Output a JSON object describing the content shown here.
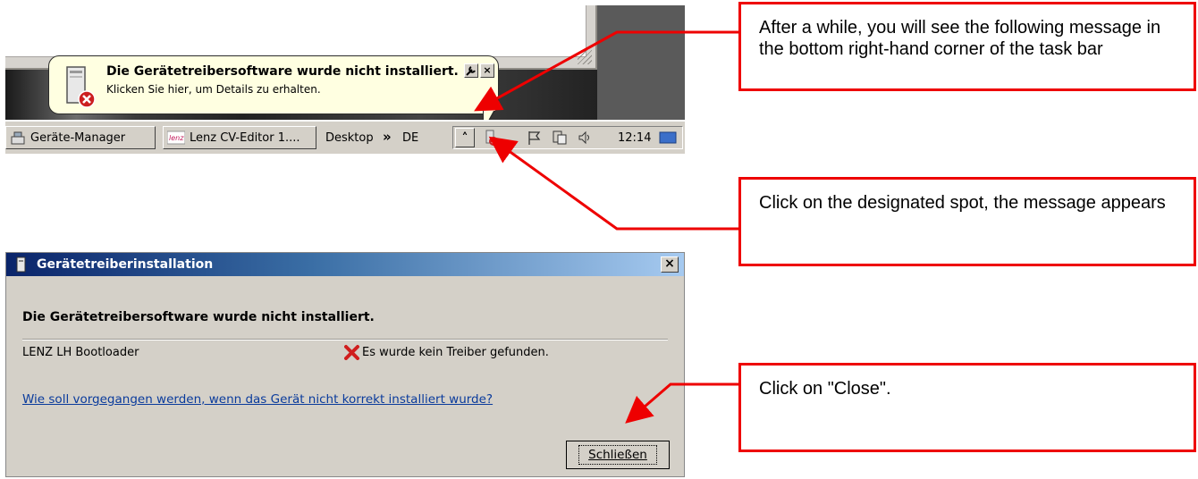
{
  "notification": {
    "title": "Die Gerätetreibersoftware wurde nicht installiert.",
    "message": "Klicken Sie hier, um Details zu erhalten.",
    "close_label": "×"
  },
  "taskbar": {
    "buttons": [
      {
        "label": "Geräte-Manager",
        "icon": "device-manager-icon"
      },
      {
        "label": "Lenz CV-Editor 1....",
        "icon": "lenz-app-icon"
      }
    ],
    "desktop_label": "Desktop",
    "expand_label": "»",
    "language": "DE",
    "tray_expand": "˄",
    "clock": "12:14"
  },
  "dialog": {
    "title": "Gerätetreiberinstallation",
    "heading": "Die Gerätetreibersoftware wurde nicht installiert.",
    "device": "LENZ LH Bootloader",
    "status": "Es wurde kein Treiber gefunden.",
    "link": "Wie soll vorgegangen werden, wenn das Gerät nicht korrekt installiert wurde?",
    "close_button": "Schließen",
    "close_x": "×"
  },
  "callouts": [
    {
      "text": "After a while, you will see the following message in the bottom right-hand corner of the task bar"
    },
    {
      "text": "Click on the designated spot, the message appears"
    },
    {
      "text": "Click on \"Close\"."
    }
  ],
  "colors": {
    "callout_border": "#ee0000",
    "titlebar": "#0a246a",
    "balloon": "#ffffe1"
  }
}
